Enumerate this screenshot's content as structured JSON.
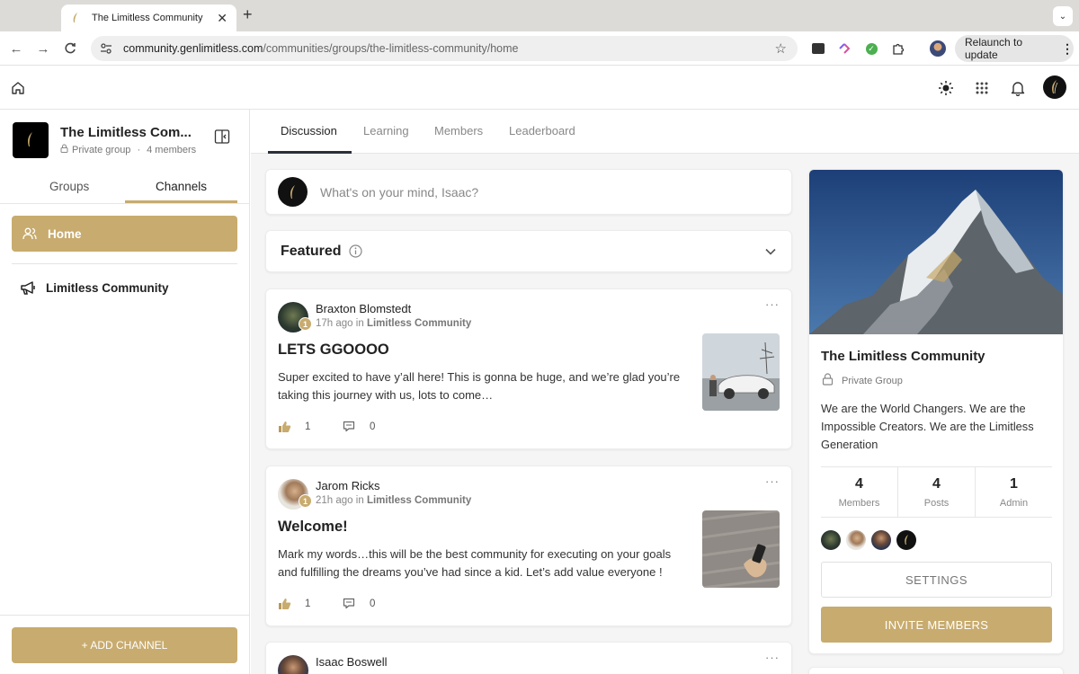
{
  "browser": {
    "tab_title": "The Limitless Community",
    "url_host": "community.genlimitless.com",
    "url_path": "/communities/groups/the-limitless-community/home",
    "relaunch_label": "Relaunch to update"
  },
  "sidebar": {
    "group_name": "The Limitless Com...",
    "group_privacy": "Private group",
    "group_separator": "·",
    "group_members": "4 members",
    "tabs": [
      "Groups",
      "Channels"
    ],
    "home_label": "Home",
    "channel_label": "Limitless Community",
    "add_channel_label": "+ ADD CHANNEL"
  },
  "main": {
    "tabs": [
      "Discussion",
      "Learning",
      "Members",
      "Leaderboard"
    ],
    "composer_placeholder": "What's on your mind, Isaac?",
    "featured_label": "Featured"
  },
  "posts": [
    {
      "author": "Braxton Blomstedt",
      "badge": "1",
      "time": "17h ago",
      "in_word": "in",
      "channel": "Limitless Community",
      "title": "LETS GGOOOO",
      "body": "Super excited to have y’all here! This is gonna be huge, and we’re glad you’re taking this journey with us, lots to come…",
      "likes": "1",
      "comments": "0"
    },
    {
      "author": "Jarom Ricks",
      "badge": "1",
      "time": "21h ago",
      "in_word": "in",
      "channel": "Limitless Community",
      "title": "Welcome!",
      "body": "Mark my words…this will be the best community for executing on your goals and fulfilling the dreams you’ve had since a kid. Let’s add value everyone !",
      "likes": "1",
      "comments": "0"
    },
    {
      "author": "Isaac Boswell"
    }
  ],
  "info": {
    "title": "The Limitless Community",
    "privacy": "Private Group",
    "description": "We are the World Changers. We are the Impossible Creators. We are the Limitless Generation",
    "stats": [
      {
        "value": "4",
        "label": "Members"
      },
      {
        "value": "4",
        "label": "Posts"
      },
      {
        "value": "1",
        "label": "Admin"
      }
    ],
    "settings_label": "SETTINGS",
    "invite_label": "INVITE MEMBERS"
  },
  "colors": {
    "accent": "#c8ab6e",
    "tab_underline": "#2a2e3a",
    "background": "#f5f5f5"
  }
}
